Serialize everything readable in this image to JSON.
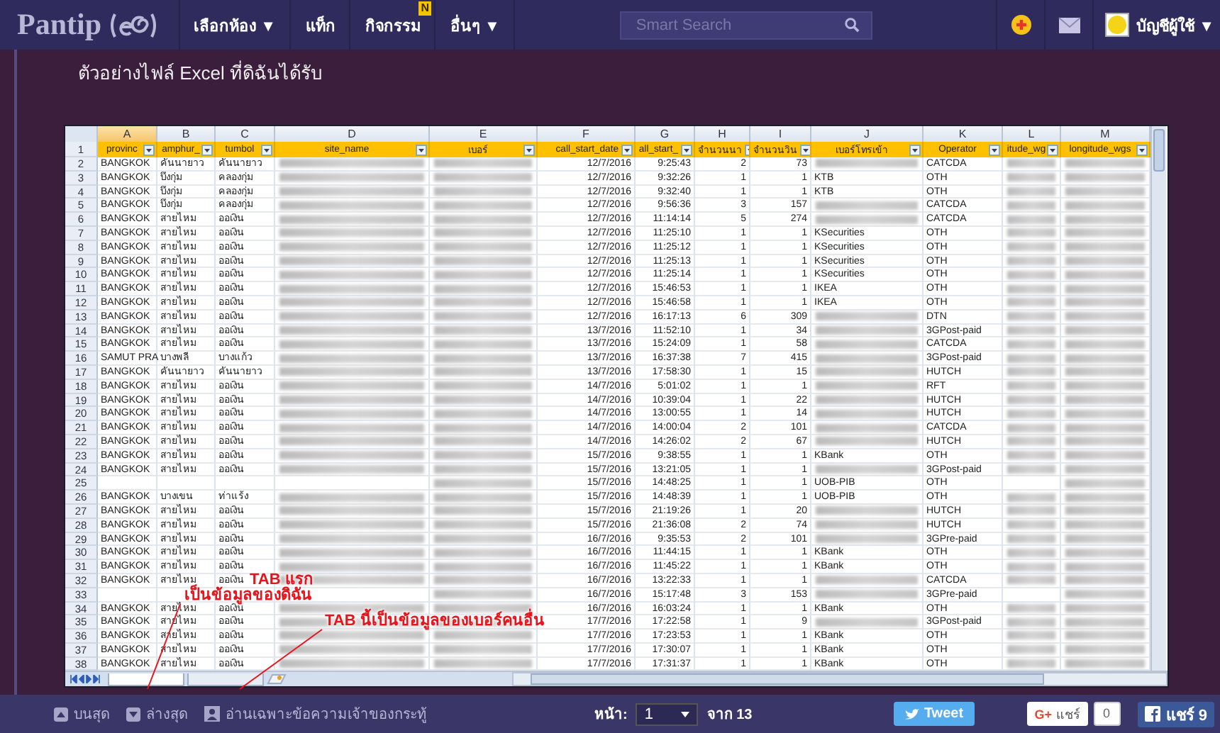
{
  "nav": {
    "logo": "Pantip",
    "menu": [
      {
        "label": "เลือกห้อง ▼"
      },
      {
        "label": "แท็ก"
      },
      {
        "label": "กิจกรรม",
        "badge": "N"
      },
      {
        "label": "อื่นๆ ▼"
      }
    ],
    "search": {
      "placeholder": "Smart Search"
    },
    "account": "บัญชีผู้ใช้ ▼"
  },
  "caption": "ตัวอย่างไฟล์ Excel ที่ดิฉันได้รับ",
  "sheet": {
    "header_row": "1",
    "columns": [
      {
        "letter": "A",
        "header": "provinc",
        "kind": "text",
        "selected": true
      },
      {
        "letter": "B",
        "header": "amphur_",
        "kind": "text",
        "selected": false
      },
      {
        "letter": "C",
        "header": "tumbol",
        "kind": "text",
        "selected": false
      },
      {
        "letter": "D",
        "header": "site_name",
        "kind": "text",
        "selected": false
      },
      {
        "letter": "E",
        "header": "เบอร์",
        "kind": "text",
        "selected": false
      },
      {
        "letter": "F",
        "header": "call_start_date",
        "kind": "number",
        "selected": false
      },
      {
        "letter": "G",
        "header": "all_start_",
        "kind": "number",
        "selected": false
      },
      {
        "letter": "H",
        "header": "จำนวนนา",
        "kind": "number",
        "selected": false
      },
      {
        "letter": "I",
        "header": "จำนวนวิน",
        "kind": "number",
        "selected": false
      },
      {
        "letter": "J",
        "header": "เบอร์โทรเข้า",
        "kind": "text",
        "selected": false
      },
      {
        "letter": "K",
        "header": "Operator",
        "kind": "text",
        "selected": false
      },
      {
        "letter": "L",
        "header": "itude_wg",
        "kind": "text",
        "selected": false
      },
      {
        "letter": "M",
        "header": "longitude_wgs",
        "kind": "text",
        "selected": false
      }
    ],
    "rows": [
      {
        "n": "2",
        "cells": [
          "BANGKOK",
          "คันนายาว",
          "คันนายาว",
          {
            "redacted": true
          },
          {
            "redacted": true
          },
          "12/7/2016",
          "9:25:43",
          "2",
          "73",
          {
            "redacted": true
          },
          "CATCDA",
          {
            "redacted": true
          },
          {
            "redacted": true
          }
        ]
      },
      {
        "n": "3",
        "cells": [
          "BANGKOK",
          "บึงกุ่ม",
          "คลองกุ่ม",
          {
            "redacted": true
          },
          {
            "redacted": true
          },
          "12/7/2016",
          "9:32:26",
          "1",
          "1",
          "KTB",
          "OTH",
          {
            "redacted": true
          },
          {
            "redacted": true
          }
        ]
      },
      {
        "n": "4",
        "cells": [
          "BANGKOK",
          "บึงกุ่ม",
          "คลองกุ่ม",
          {
            "redacted": true
          },
          {
            "redacted": true
          },
          "12/7/2016",
          "9:32:40",
          "1",
          "1",
          "KTB",
          "OTH",
          {
            "redacted": true
          },
          {
            "redacted": true
          }
        ]
      },
      {
        "n": "5",
        "cells": [
          "BANGKOK",
          "บึงกุ่ม",
          "คลองกุ่ม",
          {
            "redacted": true
          },
          {
            "redacted": true
          },
          "12/7/2016",
          "9:56:36",
          "3",
          "157",
          {
            "redacted": true
          },
          "CATCDA",
          {
            "redacted": true
          },
          {
            "redacted": true
          }
        ]
      },
      {
        "n": "6",
        "cells": [
          "BANGKOK",
          "สายไหม",
          "ออเงิน",
          {
            "redacted": true
          },
          {
            "redacted": true
          },
          "12/7/2016",
          "11:14:14",
          "5",
          "274",
          {
            "redacted": true
          },
          "CATCDA",
          {
            "redacted": true
          },
          {
            "redacted": true
          }
        ]
      },
      {
        "n": "7",
        "cells": [
          "BANGKOK",
          "สายไหม",
          "ออเงิน",
          {
            "redacted": true
          },
          {
            "redacted": true
          },
          "12/7/2016",
          "11:25:10",
          "1",
          "1",
          "KSecurities",
          "OTH",
          {
            "redacted": true
          },
          {
            "redacted": true
          }
        ]
      },
      {
        "n": "8",
        "cells": [
          "BANGKOK",
          "สายไหม",
          "ออเงิน",
          {
            "redacted": true
          },
          {
            "redacted": true
          },
          "12/7/2016",
          "11:25:12",
          "1",
          "1",
          "KSecurities",
          "OTH",
          {
            "redacted": true
          },
          {
            "redacted": true
          }
        ]
      },
      {
        "n": "9",
        "cells": [
          "BANGKOK",
          "สายไหม",
          "ออเงิน",
          {
            "redacted": true
          },
          {
            "redacted": true
          },
          "12/7/2016",
          "11:25:13",
          "1",
          "1",
          "KSecurities",
          "OTH",
          {
            "redacted": true
          },
          {
            "redacted": true
          }
        ]
      },
      {
        "n": "10",
        "cells": [
          "BANGKOK",
          "สายไหม",
          "ออเงิน",
          {
            "redacted": true
          },
          {
            "redacted": true
          },
          "12/7/2016",
          "11:25:14",
          "1",
          "1",
          "KSecurities",
          "OTH",
          {
            "redacted": true
          },
          {
            "redacted": true
          }
        ]
      },
      {
        "n": "11",
        "cells": [
          "BANGKOK",
          "สายไหม",
          "ออเงิน",
          {
            "redacted": true
          },
          {
            "redacted": true
          },
          "12/7/2016",
          "15:46:53",
          "1",
          "1",
          "IKEA",
          "OTH",
          {
            "redacted": true
          },
          {
            "redacted": true
          }
        ]
      },
      {
        "n": "12",
        "cells": [
          "BANGKOK",
          "สายไหม",
          "ออเงิน",
          {
            "redacted": true
          },
          {
            "redacted": true
          },
          "12/7/2016",
          "15:46:58",
          "1",
          "1",
          "IKEA",
          "OTH",
          {
            "redacted": true
          },
          {
            "redacted": true
          }
        ]
      },
      {
        "n": "13",
        "cells": [
          "BANGKOK",
          "สายไหม",
          "ออเงิน",
          {
            "redacted": true
          },
          {
            "redacted": true
          },
          "12/7/2016",
          "16:17:13",
          "6",
          "309",
          {
            "redacted": true
          },
          "DTN",
          {
            "redacted": true
          },
          {
            "redacted": true
          }
        ]
      },
      {
        "n": "14",
        "cells": [
          "BANGKOK",
          "สายไหม",
          "ออเงิน",
          {
            "redacted": true
          },
          {
            "redacted": true
          },
          "13/7/2016",
          "11:52:10",
          "1",
          "34",
          {
            "redacted": true
          },
          "3GPost-paid",
          {
            "redacted": true
          },
          {
            "redacted": true
          }
        ]
      },
      {
        "n": "15",
        "cells": [
          "BANGKOK",
          "สายไหม",
          "ออเงิน",
          {
            "redacted": true
          },
          {
            "redacted": true
          },
          "13/7/2016",
          "15:24:09",
          "1",
          "58",
          {
            "redacted": true
          },
          "CATCDA",
          {
            "redacted": true
          },
          {
            "redacted": true
          }
        ]
      },
      {
        "n": "16",
        "cells": [
          "SAMUT PRA",
          "บางพลี",
          "บางแก้ว",
          {
            "redacted": true
          },
          {
            "redacted": true
          },
          "13/7/2016",
          "16:37:38",
          "7",
          "415",
          {
            "redacted": true
          },
          "3GPost-paid",
          {
            "redacted": true
          },
          {
            "redacted": true
          }
        ]
      },
      {
        "n": "17",
        "cells": [
          "BANGKOK",
          "คันนายาว",
          "คันนายาว",
          {
            "redacted": true
          },
          {
            "redacted": true
          },
          "13/7/2016",
          "17:58:30",
          "1",
          "15",
          {
            "redacted": true
          },
          "HUTCH",
          {
            "redacted": true
          },
          {
            "redacted": true
          }
        ]
      },
      {
        "n": "18",
        "cells": [
          "BANGKOK",
          "สายไหม",
          "ออเงิน",
          {
            "redacted": true
          },
          {
            "redacted": true
          },
          "14/7/2016",
          "5:01:02",
          "1",
          "1",
          {
            "redacted": true
          },
          "RFT",
          {
            "redacted": true
          },
          {
            "redacted": true
          }
        ]
      },
      {
        "n": "19",
        "cells": [
          "BANGKOK",
          "สายไหม",
          "ออเงิน",
          {
            "redacted": true
          },
          {
            "redacted": true
          },
          "14/7/2016",
          "10:39:04",
          "1",
          "22",
          {
            "redacted": true
          },
          "HUTCH",
          {
            "redacted": true
          },
          {
            "redacted": true
          }
        ]
      },
      {
        "n": "20",
        "cells": [
          "BANGKOK",
          "สายไหม",
          "ออเงิน",
          {
            "redacted": true
          },
          {
            "redacted": true
          },
          "14/7/2016",
          "13:00:55",
          "1",
          "14",
          {
            "redacted": true
          },
          "HUTCH",
          {
            "redacted": true
          },
          {
            "redacted": true
          }
        ]
      },
      {
        "n": "21",
        "cells": [
          "BANGKOK",
          "สายไหม",
          "ออเงิน",
          {
            "redacted": true
          },
          {
            "redacted": true
          },
          "14/7/2016",
          "14:00:04",
          "2",
          "101",
          {
            "redacted": true
          },
          "CATCDA",
          {
            "redacted": true
          },
          {
            "redacted": true
          }
        ]
      },
      {
        "n": "22",
        "cells": [
          "BANGKOK",
          "สายไหม",
          "ออเงิน",
          {
            "redacted": true
          },
          {
            "redacted": true
          },
          "14/7/2016",
          "14:26:02",
          "2",
          "67",
          {
            "redacted": true
          },
          "HUTCH",
          {
            "redacted": true
          },
          {
            "redacted": true
          }
        ]
      },
      {
        "n": "23",
        "cells": [
          "BANGKOK",
          "สายไหม",
          "ออเงิน",
          {
            "redacted": true
          },
          {
            "redacted": true
          },
          "15/7/2016",
          "9:38:55",
          "1",
          "1",
          "KBank",
          "OTH",
          {
            "redacted": true
          },
          {
            "redacted": true
          }
        ]
      },
      {
        "n": "24",
        "cells": [
          "BANGKOK",
          "สายไหม",
          "ออเงิน",
          {
            "redacted": true
          },
          {
            "redacted": true
          },
          "15/7/2016",
          "13:21:05",
          "1",
          "1",
          {
            "redacted": true
          },
          "3GPost-paid",
          {
            "redacted": true
          },
          {
            "redacted": true
          }
        ]
      },
      {
        "n": "25",
        "cells": [
          {
            "redacted": false
          },
          {
            "redacted": false
          },
          {
            "redacted": false
          },
          {
            "redacted": false
          },
          {
            "redacted": true
          },
          "15/7/2016",
          "14:48:25",
          "1",
          "1",
          "UOB-PIB",
          "OTH",
          {
            "redacted": false
          },
          {
            "redacted": true
          }
        ]
      },
      {
        "n": "26",
        "cells": [
          "BANGKOK",
          "บางเขน",
          "ท่าแร้ง",
          {
            "redacted": true
          },
          {
            "redacted": true
          },
          "15/7/2016",
          "14:48:39",
          "1",
          "1",
          "UOB-PIB",
          "OTH",
          {
            "redacted": true
          },
          {
            "redacted": true
          }
        ]
      },
      {
        "n": "27",
        "cells": [
          "BANGKOK",
          "สายไหม",
          "ออเงิน",
          {
            "redacted": true
          },
          {
            "redacted": true
          },
          "15/7/2016",
          "21:19:26",
          "1",
          "20",
          {
            "redacted": true
          },
          "HUTCH",
          {
            "redacted": true
          },
          {
            "redacted": true
          }
        ]
      },
      {
        "n": "28",
        "cells": [
          "BANGKOK",
          "สายไหม",
          "ออเงิน",
          {
            "redacted": true
          },
          {
            "redacted": true
          },
          "15/7/2016",
          "21:36:08",
          "2",
          "74",
          {
            "redacted": true
          },
          "HUTCH",
          {
            "redacted": true
          },
          {
            "redacted": true
          }
        ]
      },
      {
        "n": "29",
        "cells": [
          "BANGKOK",
          "สายไหม",
          "ออเงิน",
          {
            "redacted": true
          },
          {
            "redacted": true
          },
          "16/7/2016",
          "9:35:53",
          "2",
          "101",
          {
            "redacted": true
          },
          "3GPre-paid",
          {
            "redacted": true
          },
          {
            "redacted": true
          }
        ]
      },
      {
        "n": "30",
        "cells": [
          "BANGKOK",
          "สายไหม",
          "ออเงิน",
          {
            "redacted": true
          },
          {
            "redacted": true
          },
          "16/7/2016",
          "11:44:15",
          "1",
          "1",
          "KBank",
          "OTH",
          {
            "redacted": true
          },
          {
            "redacted": true
          }
        ]
      },
      {
        "n": "31",
        "cells": [
          "BANGKOK",
          "สายไหม",
          "ออเงิน",
          {
            "redacted": true
          },
          {
            "redacted": true
          },
          "16/7/2016",
          "11:45:22",
          "1",
          "1",
          "KBank",
          "OTH",
          {
            "redacted": true
          },
          {
            "redacted": true
          }
        ]
      },
      {
        "n": "32",
        "cells": [
          "BANGKOK",
          "สายไหม",
          "ออเงิน",
          {
            "redacted": true
          },
          {
            "redacted": true
          },
          "16/7/2016",
          "13:22:33",
          "1",
          "1",
          {
            "redacted": true
          },
          "CATCDA",
          {
            "redacted": true
          },
          {
            "redacted": true
          }
        ]
      },
      {
        "n": "33",
        "cells": [
          {
            "redacted": false
          },
          {
            "redacted": false
          },
          {
            "redacted": false
          },
          {
            "redacted": false
          },
          {
            "redacted": true
          },
          "16/7/2016",
          "15:17:48",
          "3",
          "153",
          {
            "redacted": true
          },
          "3GPre-paid",
          {
            "redacted": false
          },
          {
            "redacted": true
          }
        ]
      },
      {
        "n": "34",
        "cells": [
          "BANGKOK",
          "สายไหม",
          "ออเงิน",
          {
            "redacted": true
          },
          {
            "redacted": true
          },
          "16/7/2016",
          "16:03:24",
          "1",
          "1",
          "KBank",
          "OTH",
          {
            "redacted": true
          },
          {
            "redacted": true
          }
        ]
      },
      {
        "n": "35",
        "cells": [
          "BANGKOK",
          "สายไหม",
          "ออเงิน",
          {
            "redacted": true
          },
          {
            "redacted": true
          },
          "17/7/2016",
          "17:22:58",
          "1",
          "9",
          {
            "redacted": true
          },
          "3GPost-paid",
          {
            "redacted": true
          },
          {
            "redacted": true
          }
        ]
      },
      {
        "n": "36",
        "cells": [
          "BANGKOK",
          "สายไหม",
          "ออเงิน",
          {
            "redacted": true
          },
          {
            "redacted": true
          },
          "17/7/2016",
          "17:23:53",
          "1",
          "1",
          "KBank",
          "OTH",
          {
            "redacted": true
          },
          {
            "redacted": true
          }
        ]
      },
      {
        "n": "37",
        "cells": [
          "BANGKOK",
          "สายไหม",
          "ออเงิน",
          {
            "redacted": true
          },
          {
            "redacted": true
          },
          "17/7/2016",
          "17:30:07",
          "1",
          "1",
          "KBank",
          "OTH",
          {
            "redacted": true
          },
          {
            "redacted": true
          }
        ]
      },
      {
        "n": "38",
        "cells": [
          "BANGKOK",
          "สายไหม",
          "ออเงิน",
          {
            "redacted": true
          },
          {
            "redacted": true
          },
          "17/7/2016",
          "17:31:37",
          "1",
          "1",
          "KBank",
          "OTH",
          {
            "redacted": true
          },
          {
            "redacted": true
          }
        ]
      }
    ],
    "sheet_tabs": [
      {
        "selected": true
      },
      {
        "selected": false
      }
    ],
    "annotations": [
      {
        "lines": [
          "TAB แรก",
          "เป็นข้อมูลของดิฉัน"
        ]
      },
      {
        "lines": [
          "TAB นี้เป็นข้อมูลของเบอร์คนอื่น"
        ]
      }
    ]
  },
  "footer": {
    "top": "บนสุด",
    "bottom": "ล่างสุด",
    "owner_only": "อ่านเฉพาะข้อความเจ้าของกระทู้",
    "page_label": "หน้า:",
    "page": "1",
    "page_total": "จาก 13",
    "tweet": "Tweet",
    "gplus_mark": "G+",
    "gplus": "แชร์",
    "gplus_count": "0",
    "facebook": "แชร์ 9"
  }
}
